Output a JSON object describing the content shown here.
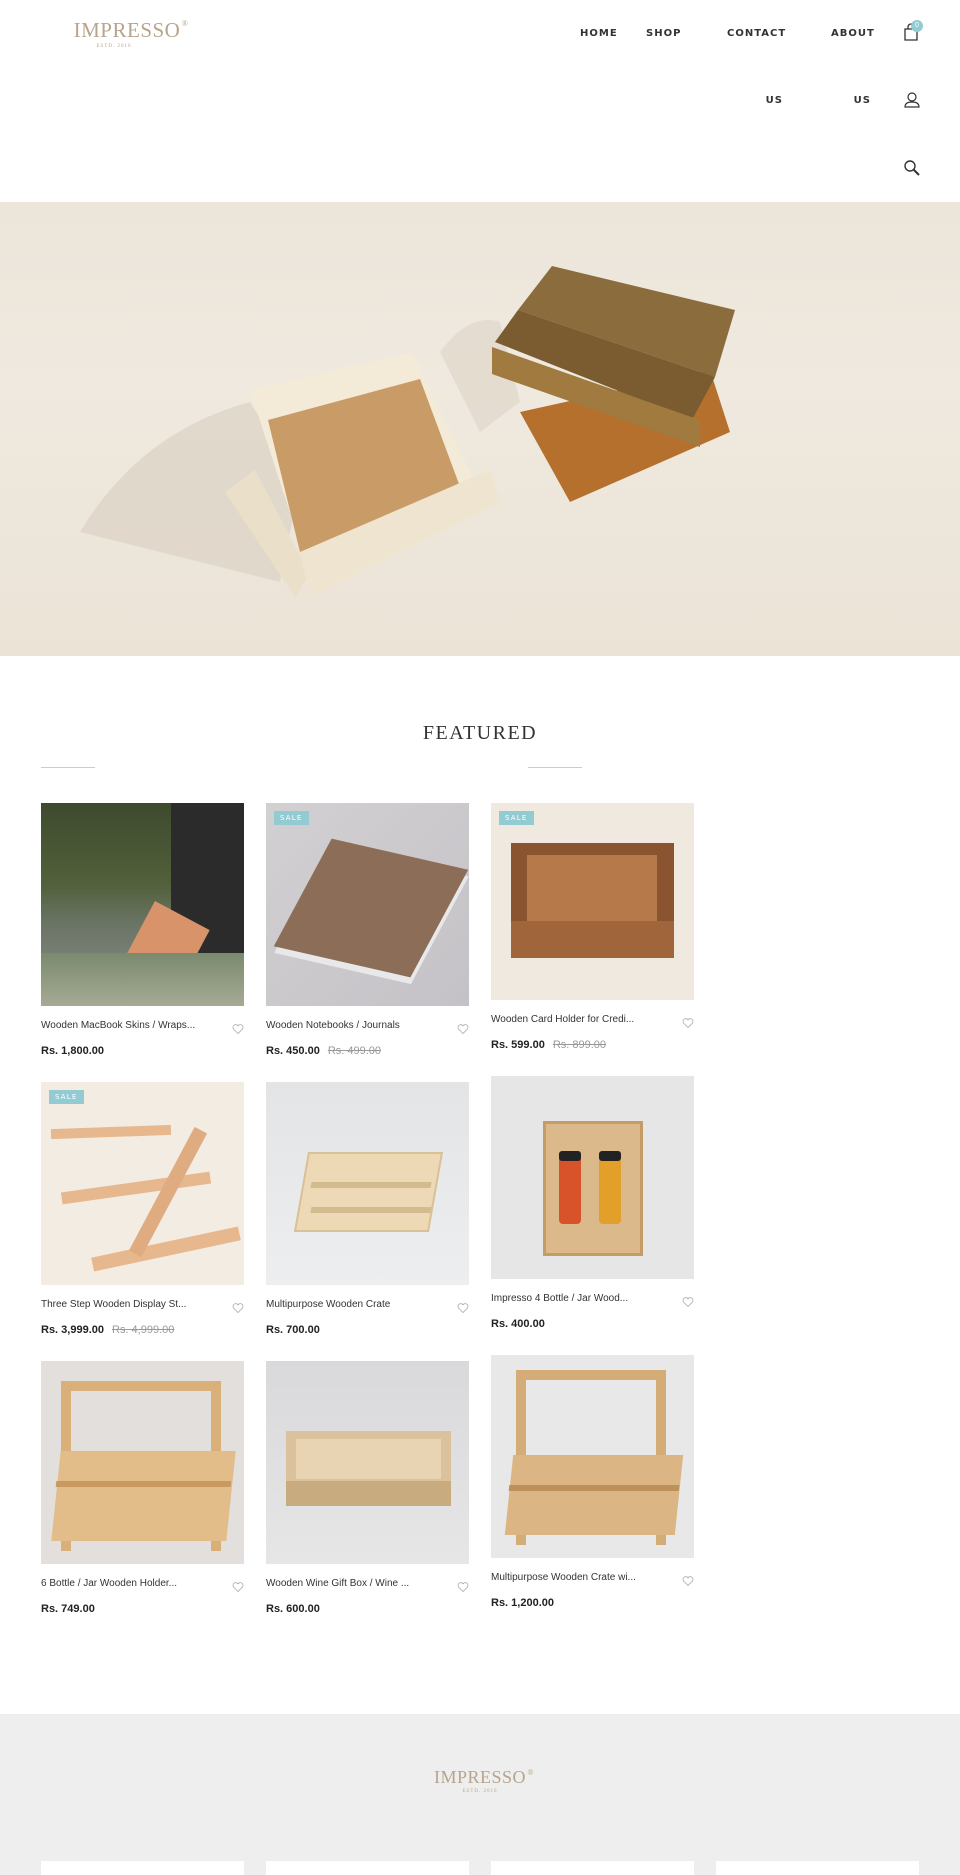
{
  "header": {
    "logo": {
      "brand": "IMPRESSO",
      "reg": "®",
      "tagline": "ESTD. 2016"
    },
    "nav": [
      {
        "label": "HOME"
      },
      {
        "label": "SHOP"
      },
      {
        "label": "CONTACT US"
      },
      {
        "label": "ABOUT US"
      }
    ],
    "icons": {
      "cart": "shopping-bag-icon",
      "user": "user-icon",
      "search": "search-icon"
    },
    "cart_count": "0"
  },
  "hero": {
    "alt": "Wooden card holder and wooden boxes"
  },
  "featured": {
    "title": "FEATURED",
    "sale_label": "SALE",
    "products": [
      {
        "name": "Wooden MacBook Skins / Wraps...",
        "price": "Rs. 1,800.00",
        "old_price": "",
        "sale": false
      },
      {
        "name": "Wooden Notebooks / Journals",
        "price": "Rs. 450.00",
        "old_price": "Rs. 499.00",
        "sale": true
      },
      {
        "name": "Wooden Card Holder for Credi...",
        "price": "Rs. 599.00",
        "old_price": "Rs. 899.00",
        "sale": true
      },
      {
        "name": "Three Step Wooden Display St...",
        "price": "Rs. 3,999.00",
        "old_price": "Rs. 4,999.00",
        "sale": true
      },
      {
        "name": "Multipurpose Wooden Crate",
        "price": "Rs. 700.00",
        "old_price": "",
        "sale": false
      },
      {
        "name": "Impresso 4 Bottle / Jar Wood...",
        "price": "Rs. 400.00",
        "old_price": "",
        "sale": false
      },
      {
        "name": "6 Bottle / Jar Wooden Holder...",
        "price": "Rs. 749.00",
        "old_price": "",
        "sale": false
      },
      {
        "name": "Wooden Wine Gift Box / Wine ...",
        "price": "Rs. 600.00",
        "old_price": "",
        "sale": false
      },
      {
        "name": "Multipurpose Wooden Crate wi...",
        "price": "Rs. 1,200.00",
        "old_price": "",
        "sale": false
      }
    ]
  },
  "footer": {
    "brand": "IMPRESSO",
    "reg": "®",
    "tagline": "ESTD. 2016"
  },
  "colors": {
    "brand": "#b8a48c",
    "accent": "#93cbd3",
    "footer_bg": "#eeeeee"
  }
}
